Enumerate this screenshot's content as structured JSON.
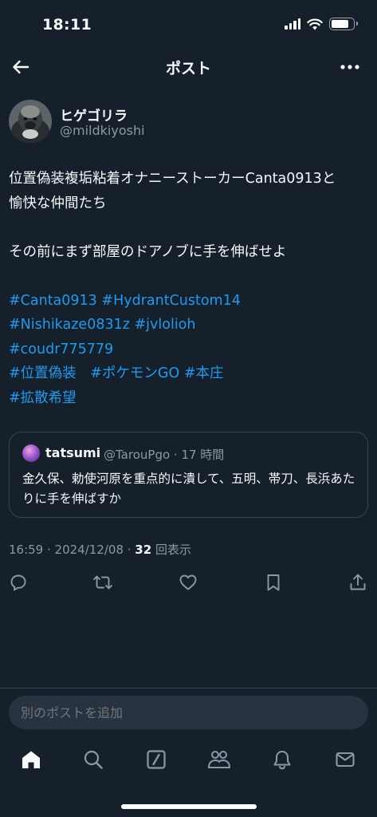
{
  "status_bar": {
    "time": "18:11"
  },
  "header": {
    "title": "ポスト"
  },
  "author": {
    "display_name": "ヒゲゴリラ",
    "handle": "@mildkiyoshi"
  },
  "post": {
    "lines": [
      "位置偽装複垢粘着オナニーストーカーCanta0913と",
      "愉快な仲間たち",
      "",
      "その前にまず部屋のドアノブに手を伸ばせよ",
      ""
    ],
    "hashtag_lines": [
      [
        "#Canta0913",
        "#HydrantCustom14"
      ],
      [
        "#Nishikaze0831z",
        "#jvlolioh"
      ],
      [
        "#coudr775779"
      ],
      [
        "#位置偽装",
        "#ポケモンGO",
        "#本庄"
      ],
      [
        "#拡散希望"
      ]
    ]
  },
  "quote": {
    "name": "tatsumi",
    "meta": "@TarouPgo · 17 時間",
    "text": "金久保、勅使河原を重点的に潰して、五明、帯刀、長浜あたりに手を伸ばすか"
  },
  "timestamp": {
    "datetime": "16:59 · 2024/12/08 · ",
    "views_count": "32",
    "views_label": " 回表示"
  },
  "reply": {
    "placeholder": "別のポストを追加"
  },
  "icons": {
    "actions": [
      "reply-icon",
      "repost-icon",
      "like-icon",
      "bookmark-icon",
      "share-icon"
    ],
    "tabs": [
      "home-icon",
      "search-icon",
      "grok-icon",
      "communities-icon",
      "notifications-icon",
      "messages-icon"
    ]
  },
  "colors": {
    "background": "#15202b",
    "accent": "#1d9bf0",
    "secondary_text": "#8b98a5",
    "border": "#38444d"
  }
}
